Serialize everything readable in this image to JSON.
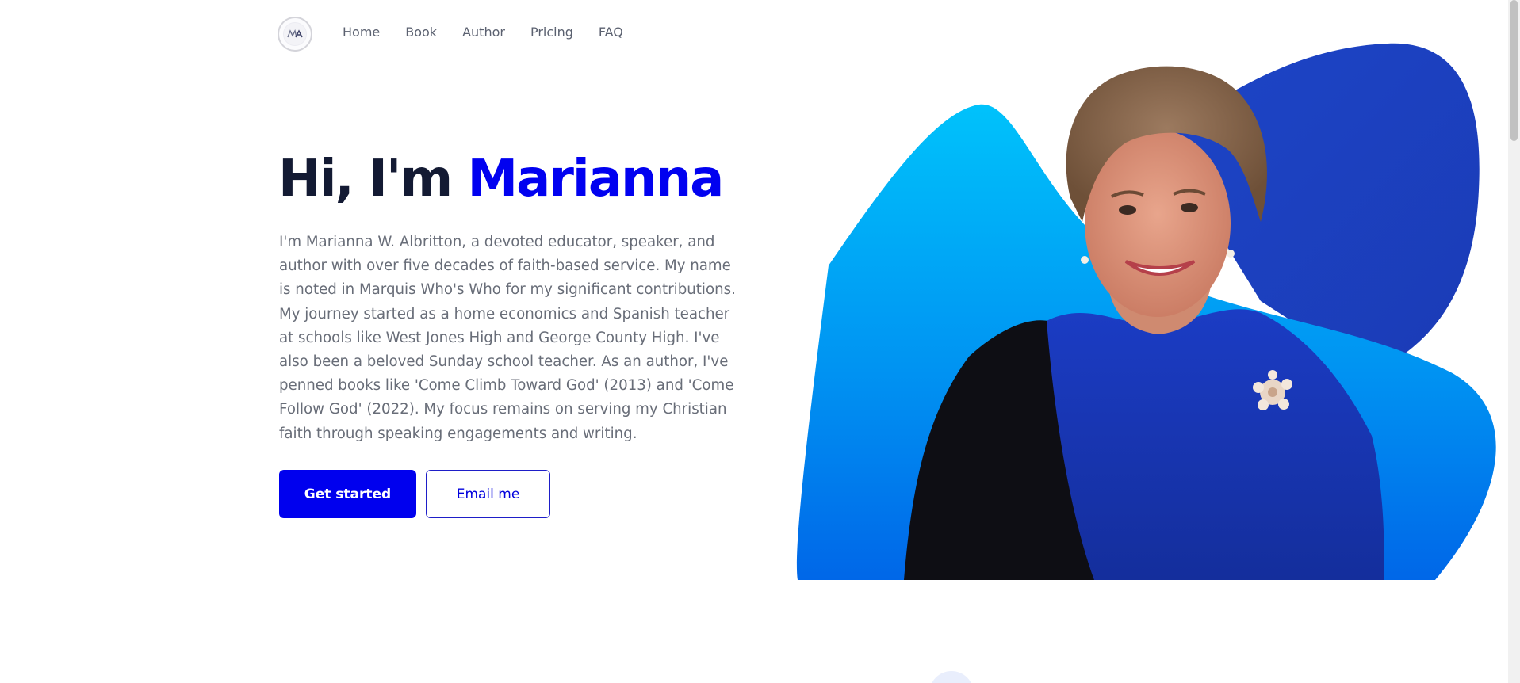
{
  "header": {
    "logo_monogram": "MA",
    "nav": [
      {
        "label": "Home"
      },
      {
        "label": "Book"
      },
      {
        "label": "Author"
      },
      {
        "label": "Pricing"
      },
      {
        "label": "FAQ"
      }
    ]
  },
  "hero": {
    "title_prefix": "Hi, I'm ",
    "title_name": "Marianna",
    "bio": "I'm Marianna W. Albritton, a devoted educator, speaker, and author with over five decades of faith-based service. My name is noted in Marquis Who's Who for my significant contributions. My journey started as a home economics and Spanish teacher at schools like West Jones High and George County High. I've also been a beloved Sunday school teacher. As an author, I've penned books like 'Come Climb Toward God' (2013) and 'Come Follow God' (2022). My focus remains on serving my Christian faith through speaking engagements and writing.",
    "primary_button": "Get started",
    "secondary_button": "Email me"
  },
  "colors": {
    "accent": "#0101f0",
    "heading": "#131a33",
    "body_text": "#686d78",
    "blob_light": "#00b8f8",
    "blob_dark": "#1e3fbf"
  },
  "icons": {
    "logo": "monogram-logo-icon"
  }
}
